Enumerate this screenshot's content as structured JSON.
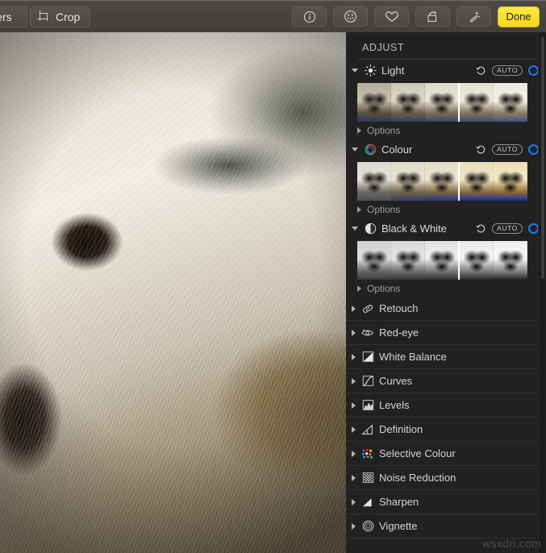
{
  "toolbar": {
    "filters_label": "ters",
    "crop_label": "Crop",
    "crop_icon": "crop-icon",
    "buttons": [
      {
        "name": "info-button",
        "icon": "info-circle-icon"
      },
      {
        "name": "faces-button",
        "icon": "faces-circle-icon"
      },
      {
        "name": "favorite-button",
        "icon": "heart-icon"
      },
      {
        "name": "rotate-button",
        "icon": "rotate-counterclockwise-icon"
      },
      {
        "name": "enhance-button",
        "icon": "magic-wand-icon"
      }
    ],
    "done_label": "Done",
    "done_color": "#f4d71d"
  },
  "panel": {
    "title": "ADJUST",
    "accent_color": "#1f7bf0",
    "auto_label": "AUTO",
    "options_label": "Options",
    "expanded_sections": [
      {
        "id": "light",
        "label": "Light",
        "icon": "sun-icon",
        "expanded": true,
        "has_undo": true,
        "has_auto": true,
        "has_toggle": true,
        "thumbnail_count": 5,
        "divider_after_thumb": 2
      },
      {
        "id": "colour",
        "label": "Colour",
        "icon": "colour-wheel-icon",
        "expanded": true,
        "has_undo": true,
        "has_auto": true,
        "has_toggle": true,
        "thumbnail_count": 5,
        "divider_after_thumb": 2
      },
      {
        "id": "black-and-white",
        "label": "Black & White",
        "icon": "half-circle-contrast-icon",
        "expanded": true,
        "has_undo": true,
        "has_auto": true,
        "has_toggle": true,
        "thumbnail_count": 5,
        "divider_after_thumb": 2
      }
    ],
    "collapsed_sections": [
      {
        "id": "retouch",
        "label": "Retouch",
        "icon": "bandage-icon"
      },
      {
        "id": "red-eye",
        "label": "Red-eye",
        "icon": "eye-icon"
      },
      {
        "id": "white-balance",
        "label": "White Balance",
        "icon": "white-balance-icon"
      },
      {
        "id": "curves",
        "label": "Curves",
        "icon": "curves-icon"
      },
      {
        "id": "levels",
        "label": "Levels",
        "icon": "levels-icon"
      },
      {
        "id": "definition",
        "label": "Definition",
        "icon": "definition-icon"
      },
      {
        "id": "selective-colour",
        "label": "Selective Colour",
        "icon": "selective-colour-dots-icon"
      },
      {
        "id": "noise-reduction",
        "label": "Noise Reduction",
        "icon": "noise-grid-icon"
      },
      {
        "id": "sharpen",
        "label": "Sharpen",
        "icon": "sharpen-triangle-icon"
      },
      {
        "id": "vignette",
        "label": "Vignette",
        "icon": "vignette-rings-icon"
      }
    ]
  },
  "canvas": {
    "photo_description": "Close-up photo of a white terrier dog's face showing one dark eye and light fur"
  },
  "watermark": "wsxdn.com"
}
